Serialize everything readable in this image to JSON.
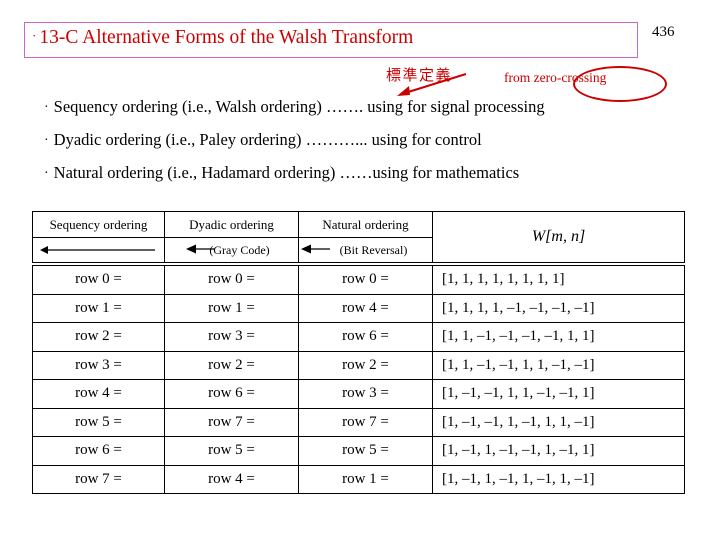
{
  "slide": {
    "title_bullet": "·",
    "title": "13-C  Alternative Forms of the Walsh Transform",
    "page_number": "436",
    "annotations": {
      "cjk_note": "標準定義",
      "zero_crossing": "from zero-crossing"
    },
    "bullets": [
      "Sequency ordering (i.e., Walsh ordering) ……. using for signal processing",
      "Dyadic ordering (i.e., Paley ordering) ………... using for control",
      "Natural ordering (i.e., Hadamard ordering) ……using for mathematics"
    ],
    "bullet_marker": "·"
  },
  "table": {
    "headers": [
      "Sequency ordering",
      "Dyadic ordering",
      "Natural ordering",
      "W[m, n]"
    ],
    "subheaders": [
      "",
      "(Gray Code)",
      "(Bit Reversal)",
      ""
    ],
    "rows": [
      {
        "sequency": "row 0 =",
        "dyadic": "row 0 =",
        "natural": "row 0 =",
        "vector": "[1, 1, 1, 1, 1, 1, 1, 1]"
      },
      {
        "sequency": "row 1 =",
        "dyadic": "row 1 =",
        "natural": "row 4 =",
        "vector": "[1, 1, 1, 1, –1, –1, –1, –1]"
      },
      {
        "sequency": "row 2 =",
        "dyadic": "row 3 =",
        "natural": "row 6 =",
        "vector": "[1, 1, –1, –1, –1, –1, 1, 1]"
      },
      {
        "sequency": "row 3 =",
        "dyadic": "row 2 =",
        "natural": "row 2 =",
        "vector": "[1, 1, –1, –1, 1, 1, –1, –1]"
      },
      {
        "sequency": "row 4 =",
        "dyadic": "row 6 =",
        "natural": "row 3 =",
        "vector": "[1, –1, –1, 1, 1, –1, –1, 1]"
      },
      {
        "sequency": "row 5 =",
        "dyadic": "row 7 =",
        "natural": "row 7 =",
        "vector": "[1, –1, –1, 1, –1, 1, 1, –1]"
      },
      {
        "sequency": "row 6 =",
        "dyadic": "row 5 =",
        "natural": "row 5 =",
        "vector": "[1, –1, 1, –1, –1, 1, –1, 1]"
      },
      {
        "sequency": "row 7 =",
        "dyadic": "row 4 =",
        "natural": "row 1 =",
        "vector": "[1, –1, 1, –1, 1, –1, 1, –1]"
      }
    ]
  },
  "colors": {
    "title_text": "#cc0000",
    "title_border": "#cc66cc",
    "annotation": "#cc0000",
    "body_text": "#000000"
  }
}
